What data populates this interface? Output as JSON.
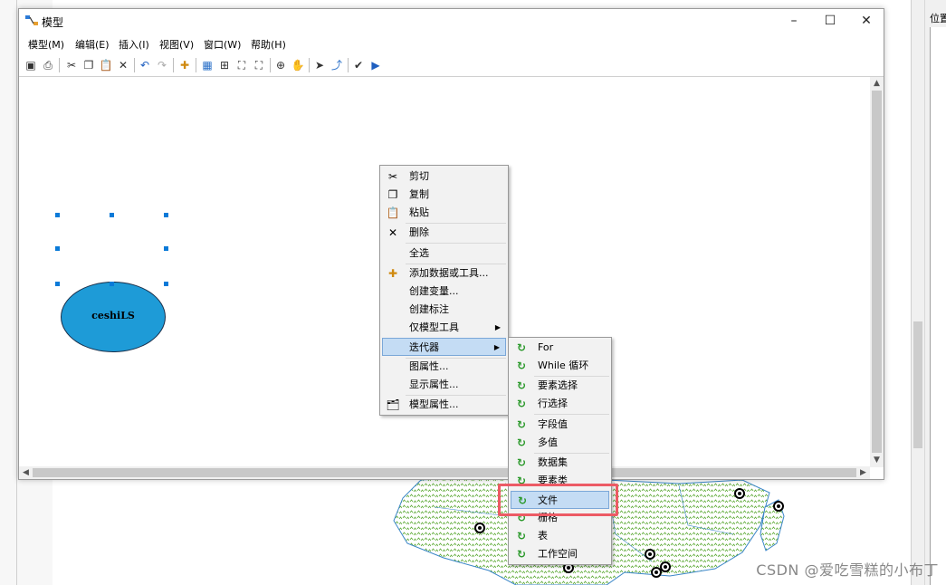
{
  "window": {
    "title": "模型",
    "minimize": "–",
    "maximize": "☐",
    "close": "✕"
  },
  "menubar": [
    "模型(M)",
    "编辑(E)",
    "插入(I)",
    "视图(V)",
    "窗口(W)",
    "帮助(H)"
  ],
  "toolbar_icons": [
    "save-icon",
    "print-icon",
    "cut-icon",
    "copy-icon",
    "paste-icon",
    "delete-icon",
    "undo-icon",
    "redo-icon",
    "add-data-icon",
    "auto-layout-icon",
    "full-extent-icon",
    "zoom-in-fixed-icon",
    "zoom-out-fixed-icon",
    "zoom-icon",
    "pan-icon",
    "select-icon",
    "connect-icon",
    "validate-icon",
    "run-icon"
  ],
  "node": {
    "label": "ceshiLS",
    "color": "#1e9bd7"
  },
  "context_menu": {
    "cut": "剪切",
    "copy": "复制",
    "paste": "粘贴",
    "delete": "删除",
    "select_all": "全选",
    "add_data": "添加数据或工具...",
    "create_variable": "创建变量...",
    "create_label": "创建标注",
    "model_only_tools": "仅模型工具",
    "iterators": "迭代器",
    "diagram_properties": "图属性...",
    "display_properties": "显示属性...",
    "model_properties": "模型属性..."
  },
  "iterator_menu": {
    "for": "For",
    "while": "While 循环",
    "feature_selection": "要素选择",
    "row_selection": "行选择",
    "field_value": "字段值",
    "multivalue": "多值",
    "datasets": "数据集",
    "feature_classes": "要素类",
    "files": "文件",
    "rasters": "栅格",
    "tables": "表",
    "workspaces": "工作空间"
  },
  "right_panel": {
    "label": "位置"
  },
  "watermark": "CSDN @爱吃雪糕的小布丁",
  "colors": {
    "highlight": "#c4dcf4",
    "annotation_box": "#ec5b65",
    "map_green": "#5aa832"
  }
}
